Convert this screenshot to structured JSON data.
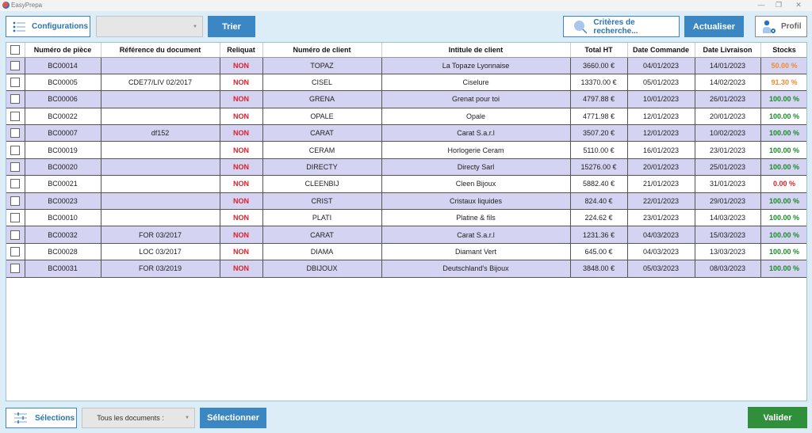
{
  "window": {
    "title": "EasyPrepa",
    "controls": [
      "—",
      "❐",
      "✕"
    ]
  },
  "toolbar": {
    "configurations_label": "Configurations",
    "config_select_value": "",
    "trier_label": "Trier",
    "criteres_label": "Critères de recherche...",
    "actualiser_label": "Actualiser",
    "profil_label": "Profil"
  },
  "colors": {
    "primary_blue": "#3a87c3",
    "valider_green": "#2f8f3a",
    "row_alt": "#d4d3f2",
    "non_red": "#e0202a",
    "stock_orange": "#f08a30",
    "stock_green": "#1a8a2a",
    "stock_red": "#e0202a"
  },
  "table": {
    "columns": [
      "",
      "Numéro de pièce",
      "Référence du document",
      "Reliquat",
      "Numéro de client",
      "Intitule de client",
      "Total HT",
      "Date Commande",
      "Date Livraison",
      "Stocks"
    ],
    "rows": [
      {
        "piece": "BC00014",
        "ref": "",
        "reliquat": "NON",
        "client_num": "TOPAZ",
        "client_name": "La Topaze Lyonnaise",
        "total": "3660.00 €",
        "date_cmd": "04/01/2023",
        "date_liv": "14/01/2023",
        "stock": "50.00 %",
        "stock_level": "orange"
      },
      {
        "piece": "BC00005",
        "ref": "CDE77/LIV 02/2017",
        "reliquat": "NON",
        "client_num": "CISEL",
        "client_name": "Ciselure",
        "total": "13370.00 €",
        "date_cmd": "05/01/2023",
        "date_liv": "14/02/2023",
        "stock": "91.30 %",
        "stock_level": "orange"
      },
      {
        "piece": "BC00006",
        "ref": "",
        "reliquat": "NON",
        "client_num": "GRENA",
        "client_name": "Grenat pour toi",
        "total": "4797.88 €",
        "date_cmd": "10/01/2023",
        "date_liv": "26/01/2023",
        "stock": "100.00 %",
        "stock_level": "green"
      },
      {
        "piece": "BC00022",
        "ref": "",
        "reliquat": "NON",
        "client_num": "OPALE",
        "client_name": "Opale",
        "total": "4771.98 €",
        "date_cmd": "12/01/2023",
        "date_liv": "20/01/2023",
        "stock": "100.00 %",
        "stock_level": "green"
      },
      {
        "piece": "BC00007",
        "ref": "df152",
        "reliquat": "NON",
        "client_num": "CARAT",
        "client_name": "Carat S.a.r.l",
        "total": "3507.20 €",
        "date_cmd": "12/01/2023",
        "date_liv": "10/02/2023",
        "stock": "100.00 %",
        "stock_level": "green"
      },
      {
        "piece": "BC00019",
        "ref": "",
        "reliquat": "NON",
        "client_num": "CERAM",
        "client_name": "Horlogerie Ceram",
        "total": "5110.00 €",
        "date_cmd": "16/01/2023",
        "date_liv": "23/01/2023",
        "stock": "100.00 %",
        "stock_level": "green"
      },
      {
        "piece": "BC00020",
        "ref": "",
        "reliquat": "NON",
        "client_num": "DIRECTY",
        "client_name": "Directy Sarl",
        "total": "15276.00 €",
        "date_cmd": "20/01/2023",
        "date_liv": "25/01/2023",
        "stock": "100.00 %",
        "stock_level": "green"
      },
      {
        "piece": "BC00021",
        "ref": "",
        "reliquat": "NON",
        "client_num": "CLEENBIJ",
        "client_name": "Cleen Bijoux",
        "total": "5882.40 €",
        "date_cmd": "21/01/2023",
        "date_liv": "31/01/2023",
        "stock": "0.00 %",
        "stock_level": "red"
      },
      {
        "piece": "BC00023",
        "ref": "",
        "reliquat": "NON",
        "client_num": "CRIST",
        "client_name": "Cristaux liquides",
        "total": "824.40 €",
        "date_cmd": "22/01/2023",
        "date_liv": "29/01/2023",
        "stock": "100.00 %",
        "stock_level": "green"
      },
      {
        "piece": "BC00010",
        "ref": "",
        "reliquat": "NON",
        "client_num": "PLATI",
        "client_name": "Platine & fils",
        "total": "224.62 €",
        "date_cmd": "23/01/2023",
        "date_liv": "14/03/2023",
        "stock": "100.00 %",
        "stock_level": "green"
      },
      {
        "piece": "BC00032",
        "ref": "FOR 03/2017",
        "reliquat": "NON",
        "client_num": "CARAT",
        "client_name": "Carat S.a.r.l",
        "total": "1231.36 €",
        "date_cmd": "04/03/2023",
        "date_liv": "15/03/2023",
        "stock": "100.00 %",
        "stock_level": "green"
      },
      {
        "piece": "BC00028",
        "ref": "LOC 03/2017",
        "reliquat": "NON",
        "client_num": "DIAMA",
        "client_name": "Diamant Vert",
        "total": "645.00 €",
        "date_cmd": "04/03/2023",
        "date_liv": "13/03/2023",
        "stock": "100.00 %",
        "stock_level": "green"
      },
      {
        "piece": "BC00031",
        "ref": "FOR 03/2019",
        "reliquat": "NON",
        "client_num": "DBIJOUX",
        "client_name": "Deutschland's Bijoux",
        "total": "3848.00 €",
        "date_cmd": "05/03/2023",
        "date_liv": "08/03/2023",
        "stock": "100.00 %",
        "stock_level": "green"
      }
    ]
  },
  "footer": {
    "selections_label": "Sélections",
    "documents_select_value": "Tous les documents :",
    "selectionner_label": "Sélectionner",
    "valider_label": "Valider"
  }
}
